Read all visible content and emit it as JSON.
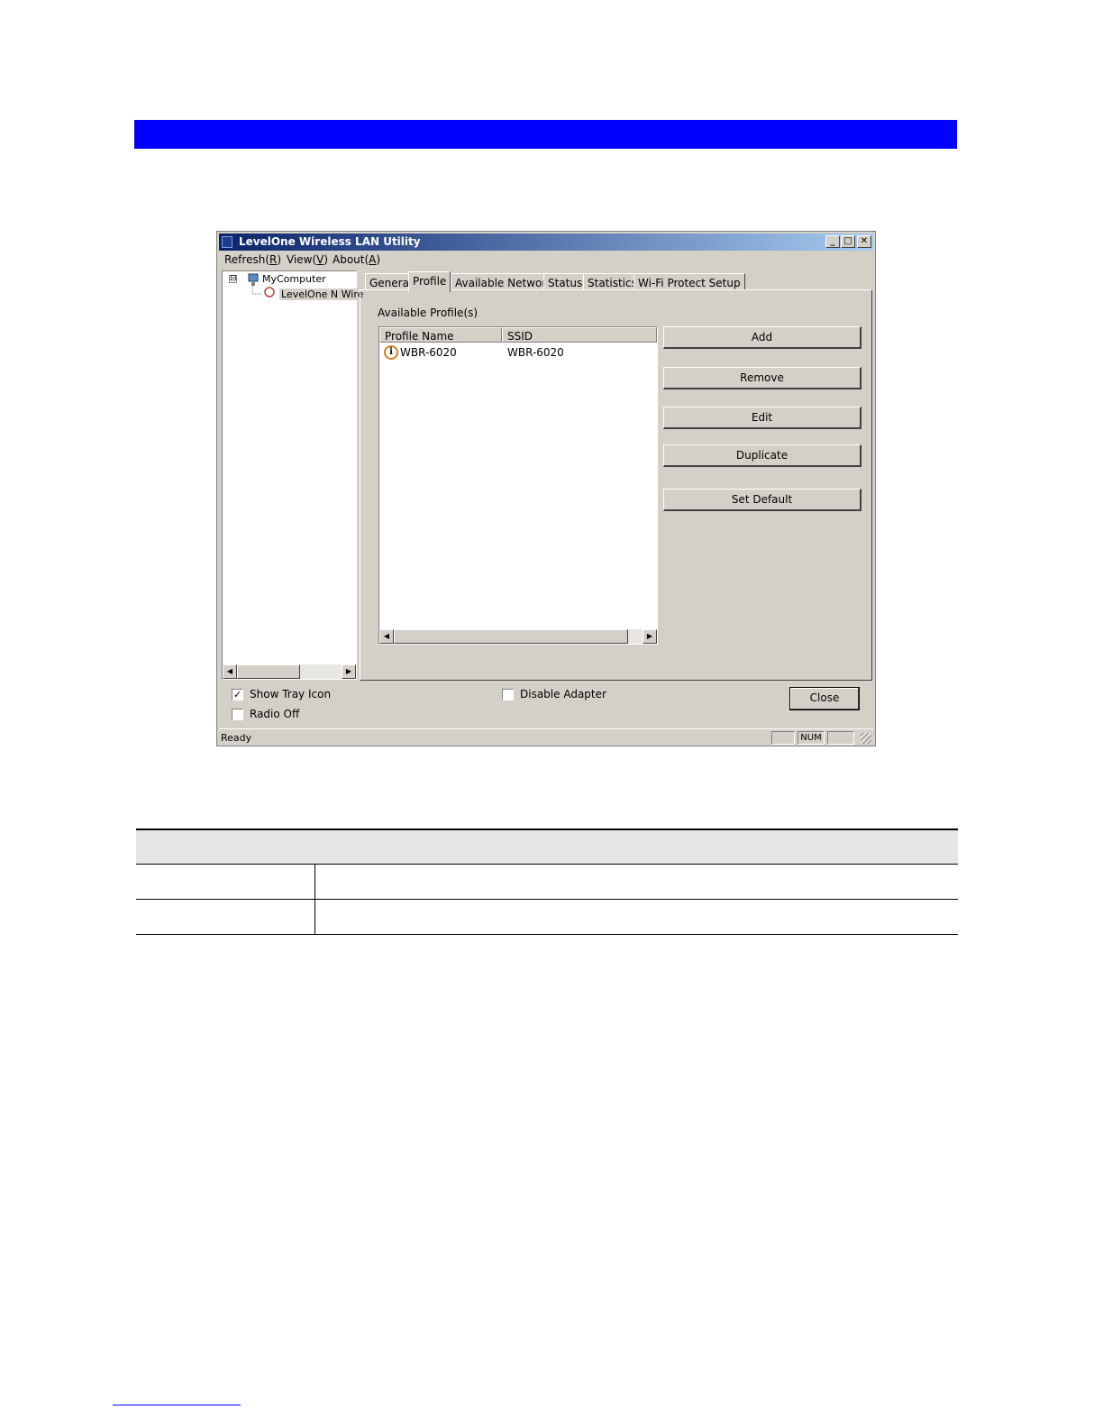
{
  "window": {
    "title": "LevelOne Wireless LAN Utility",
    "controls": {
      "minimize": "_",
      "maximize": "□",
      "close": "✕"
    }
  },
  "menu": [
    {
      "label": "Refresh(",
      "key": "R",
      "end": ")"
    },
    {
      "label": "View(",
      "key": "V",
      "end": ")"
    },
    {
      "label": "About(",
      "key": "A",
      "end": ")"
    }
  ],
  "tree": {
    "expander": "⊟",
    "root": "MyComputer",
    "child": "LevelOne N Wire"
  },
  "tabs": [
    "General",
    "Profile",
    "Available Network",
    "Status",
    "Statistics",
    "Wi-Fi Protect Setup"
  ],
  "active_tab": "Profile",
  "profile": {
    "available_label": "Available Profile(s)",
    "columns": [
      "Profile Name",
      "SSID"
    ],
    "rows": [
      {
        "name": "WBR-6020",
        "ssid": "WBR-6020"
      }
    ],
    "buttons": {
      "add": "Add",
      "remove": "Remove",
      "edit": "Edit",
      "duplicate": "Duplicate",
      "set_default": "Set Default"
    }
  },
  "options": {
    "show_tray_icon": {
      "label": "Show Tray Icon",
      "checked": true,
      "mark": "✓"
    },
    "radio_off": {
      "label": "Radio Off",
      "checked": false
    },
    "disable_adapter": {
      "label": "Disable Adapter",
      "checked": false
    }
  },
  "close_label": "Close",
  "statusbar": {
    "text": "Ready",
    "num": "NUM"
  },
  "colors": {
    "banner": "#0000ff",
    "titlebar_start": "#0a246a",
    "titlebar_end": "#a6caf0",
    "face": "#d4d0c8"
  }
}
